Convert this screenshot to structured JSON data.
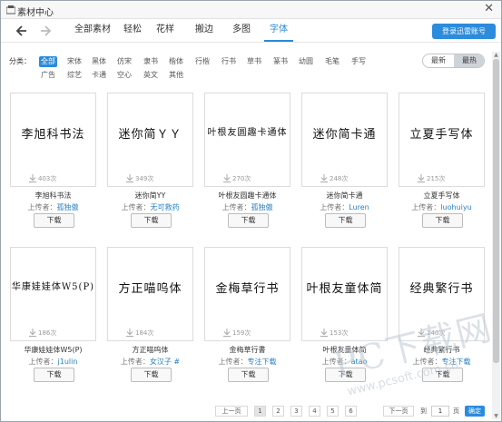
{
  "window": {
    "title": "素材中心",
    "close_glyph": "✕"
  },
  "nav": {
    "tabs": [
      "全部素材",
      "轻松",
      "花样",
      "搬边",
      "多图",
      "字体"
    ],
    "active_tab": "字体",
    "login_label": "登录迅雷账号"
  },
  "filter": {
    "label": "分类：",
    "categories_row1": [
      "全部",
      "宋体",
      "黑体",
      "仿宋",
      "隶书",
      "楷体",
      "行楷",
      "行书",
      "草书",
      "篆书",
      "幼圆",
      "毛笔",
      "手写"
    ],
    "categories_row2": [
      "广告",
      "综艺",
      "卡通",
      "空心",
      "英文",
      "其他"
    ],
    "active_category": "全部"
  },
  "sort": {
    "new_label": "最新",
    "hot_label": "最热",
    "active": "最热"
  },
  "fonts": [
    {
      "sample": "李旭科书法",
      "downloads": "403次",
      "name": "李旭科书法",
      "uploader_prefix": "上传者：",
      "uploader": "孤独傲",
      "button": "下载"
    },
    {
      "sample": "迷你简ＹＹ",
      "downloads": "349次",
      "name": "迷你简YY",
      "uploader_prefix": "上传者：",
      "uploader": "无可救药",
      "button": "下载"
    },
    {
      "sample": "叶根友圆趣卡通体",
      "downloads": "270次",
      "name": "叶根友圆趣卡通体",
      "uploader_prefix": "上传者：",
      "uploader": "孤独傲",
      "button": "下载"
    },
    {
      "sample": "迷你简卡通",
      "downloads": "248次",
      "name": "迷你简卡通",
      "uploader_prefix": "上传者：",
      "uploader": "Luren",
      "button": "下载"
    },
    {
      "sample": "立夏手写体",
      "downloads": "215次",
      "name": "立夏手写体",
      "uploader_prefix": "上传者：",
      "uploader": "luohuiyu",
      "button": "下载"
    },
    {
      "sample": "华康娃娃体W5(P)",
      "downloads": "186次",
      "name": "华康娃娃体W5(P)",
      "uploader_prefix": "上传者：",
      "uploader": "j1ulin",
      "button": "下载"
    },
    {
      "sample": "方正喵呜体",
      "downloads": "184次",
      "name": "方正喵呜体",
      "uploader_prefix": "上传者：",
      "uploader": "女汉子 #",
      "button": "下载"
    },
    {
      "sample": "金梅草行书",
      "downloads": "159次",
      "name": "金梅草行書",
      "uploader_prefix": "上传者：",
      "uploader": "专注下载",
      "button": "下载"
    },
    {
      "sample": "叶根友童体简",
      "downloads": "153次",
      "name": "叶根友童体简",
      "uploader_prefix": "上传者：",
      "uploader": "atao",
      "button": "下载"
    },
    {
      "sample": "经典繁行书",
      "downloads": "140次",
      "name": "经典繁行书",
      "uploader_prefix": "上传者：",
      "uploader": "专注下载",
      "button": "下载"
    }
  ],
  "pagination": {
    "prev": "上一页",
    "pages": [
      "1",
      "2",
      "3",
      "4",
      "5",
      "6"
    ],
    "current": "1",
    "next": "下一页",
    "goto_prefix": "到",
    "goto_value": "1",
    "goto_suffix": "页",
    "confirm": "确定"
  },
  "watermark": {
    "brand": "PC下载网",
    "url": "www.pcsoft.com.cn"
  },
  "colors": {
    "accent": "#2b8bdc",
    "link": "#2a7fc6"
  }
}
